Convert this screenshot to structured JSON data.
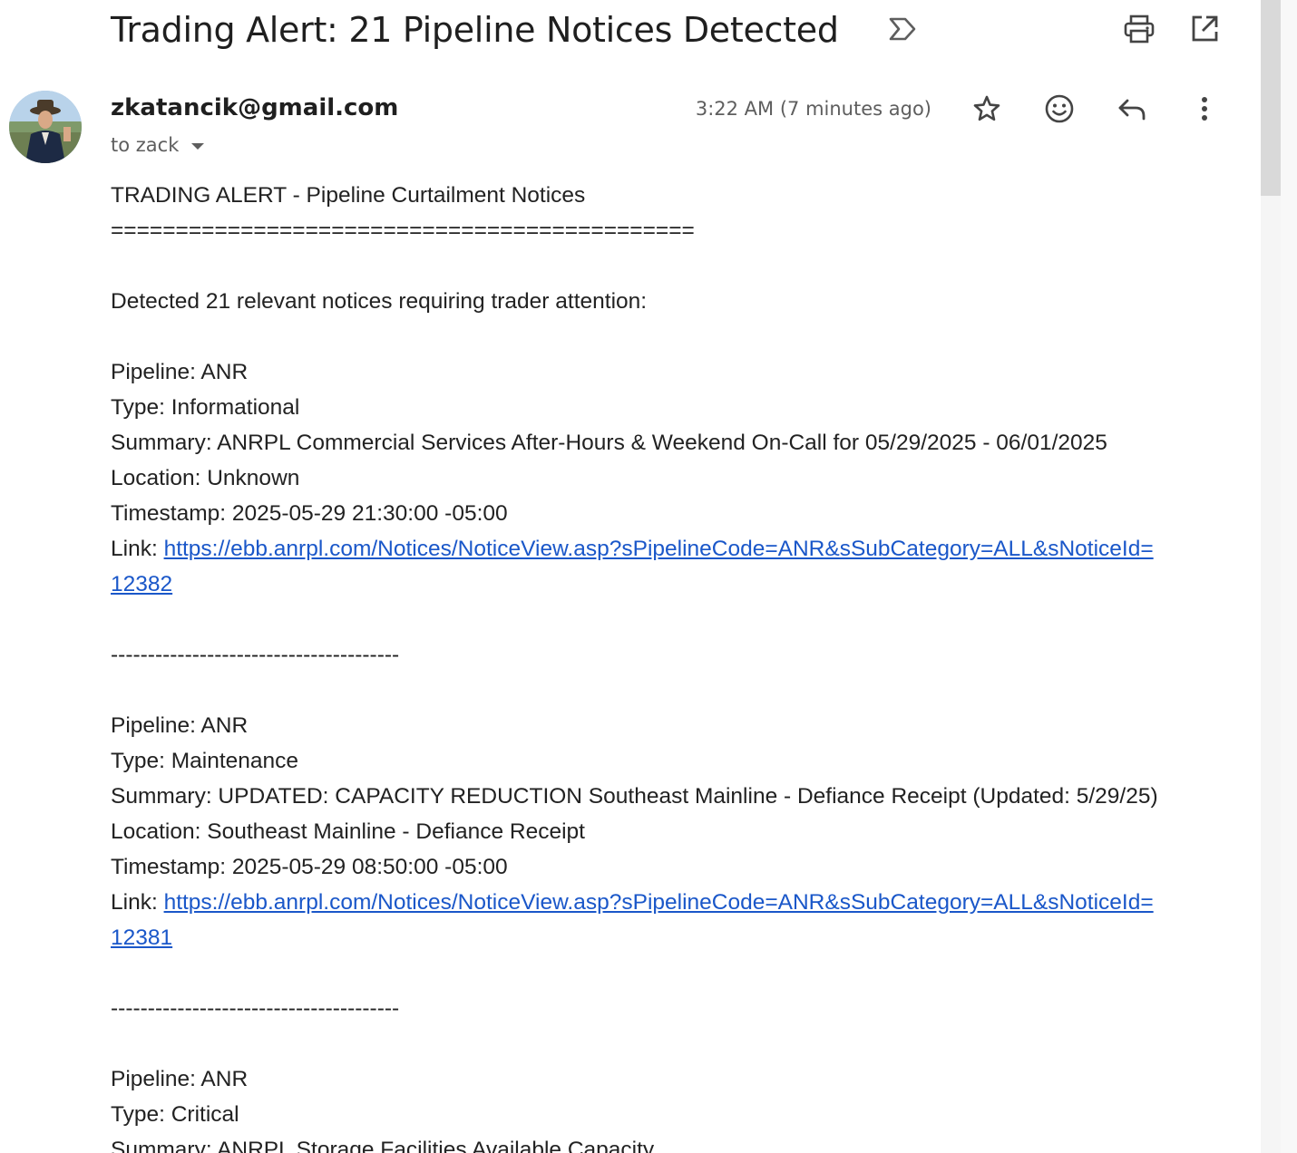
{
  "email": {
    "subject": "Trading Alert: 21 Pipeline Notices Detected",
    "sender": "zkatancik@gmail.com",
    "to_line": "to zack",
    "time": "3:22 AM (7 minutes ago)"
  },
  "icons": {
    "label": "label-important-icon",
    "print": "print-icon",
    "open_new_window": "open-in-new-window-icon",
    "star": "star-icon",
    "emoji": "emoji-reaction-icon",
    "reply": "reply-icon",
    "more": "more-vertical-icon",
    "caret": "caret-down-icon"
  },
  "body": {
    "heading": "TRADING ALERT - Pipeline Curtailment Notices",
    "rule": "=============================================",
    "intro": "Detected 21 relevant notices requiring trader attention:",
    "separator": "---------------------------------------",
    "notices": [
      {
        "pipeline": "Pipeline: ANR",
        "type": "Type: Informational",
        "summary": "Summary: ANRPL Commercial Services After-Hours & Weekend On-Call for 05/29/2025 - 06/01/2025",
        "location": "Location: Unknown",
        "timestamp": "Timestamp: 2025-05-29 21:30:00 -05:00",
        "link_label": "Link: ",
        "link_line1": "https://ebb.anrpl.com/Notices/NoticeView.asp?sPipelineCode=ANR&sSubCategory=ALL&sNoticeId=",
        "link_line2": "12382"
      },
      {
        "pipeline": "Pipeline: ANR",
        "type": "Type: Maintenance",
        "summary": "Summary: UPDATED: CAPACITY REDUCTION Southeast Mainline - Defiance Receipt (Updated: 5/29/25)",
        "location": "Location: Southeast Mainline - Defiance Receipt",
        "timestamp": "Timestamp: 2025-05-29 08:50:00 -05:00",
        "link_label": "Link: ",
        "link_line1": "https://ebb.anrpl.com/Notices/NoticeView.asp?sPipelineCode=ANR&sSubCategory=ALL&sNoticeId=",
        "link_line2": "12381"
      },
      {
        "pipeline": "Pipeline: ANR",
        "type": "Type: Critical",
        "summary": "Summary: ANRPL Storage Facilities Available Capacity"
      }
    ]
  },
  "colors": {
    "link": "#1a57c9",
    "text": "#222222",
    "muted": "#5e5e5e"
  }
}
